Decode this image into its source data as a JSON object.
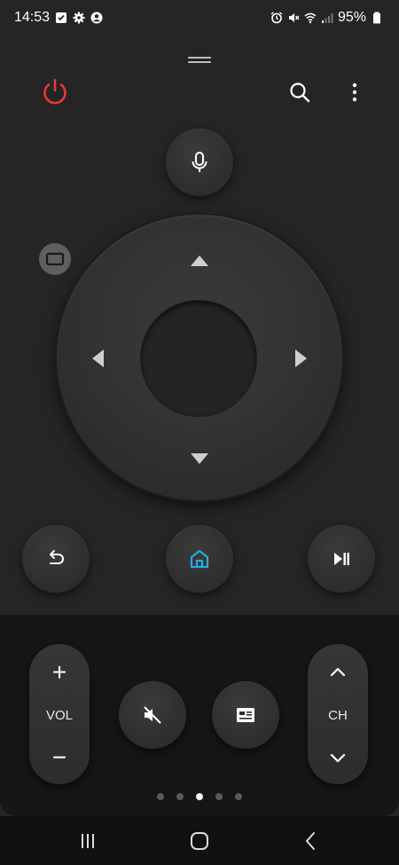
{
  "status_bar": {
    "time": "14:53",
    "battery": "95%",
    "left_icons": [
      "check-icon",
      "settings-icon",
      "account-icon"
    ],
    "right_icons": [
      "alarm-icon",
      "mute-icon",
      "wifi-icon",
      "signal-icon",
      "battery-icon"
    ]
  },
  "header": {
    "power_icon": "power-icon",
    "search_icon": "search-icon",
    "menu_icon": "more-vert-icon"
  },
  "colors": {
    "power": "#e53935",
    "home_accent": "#2aa8e0",
    "background": "#252525",
    "panel": "#161616"
  },
  "volume": {
    "plus": "+",
    "label": "VOL",
    "minus": "−"
  },
  "channel": {
    "label": "CH"
  },
  "pager": {
    "count": 5,
    "active": 2
  }
}
